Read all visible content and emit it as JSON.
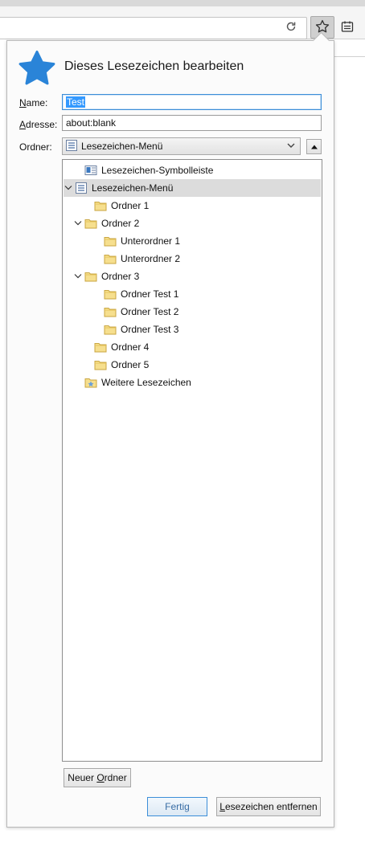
{
  "toolbar": {
    "reload_icon": "reload-icon",
    "star_icon": "star-outline-icon",
    "library_icon": "bookmarks-library-icon"
  },
  "panel": {
    "title": "Dieses Lesezeichen bearbeiten",
    "name_label": "Name:",
    "name_value": "Test",
    "address_label": "Adresse:",
    "address_value": "about:blank",
    "folder_label": "Ordner:",
    "folder_selected": "Lesezeichen-Menü"
  },
  "tree": {
    "items": [
      {
        "label": "Lesezeichen-Symbolleiste",
        "icon": "bookmarks-toolbar-icon"
      },
      {
        "label": "Lesezeichen-Menü",
        "icon": "bookmarks-menu-icon",
        "expanded": true,
        "selected": true
      },
      {
        "label": "Ordner 1",
        "icon": "folder-icon"
      },
      {
        "label": "Ordner 2",
        "icon": "folder-icon",
        "expanded": true
      },
      {
        "label": "Unterordner 1",
        "icon": "folder-icon"
      },
      {
        "label": "Unterordner 2",
        "icon": "folder-icon"
      },
      {
        "label": "Ordner 3",
        "icon": "folder-icon",
        "expanded": true
      },
      {
        "label": "Ordner Test 1",
        "icon": "folder-icon"
      },
      {
        "label": "Ordner Test 2",
        "icon": "folder-icon"
      },
      {
        "label": "Ordner Test 3",
        "icon": "folder-icon"
      },
      {
        "label": "Ordner 4",
        "icon": "folder-icon"
      },
      {
        "label": "Ordner 5",
        "icon": "folder-icon"
      },
      {
        "label": "Weitere Lesezeichen",
        "icon": "other-bookmarks-icon"
      }
    ]
  },
  "buttons": {
    "new_folder": "Neuer Ordner",
    "done": "Fertig",
    "remove": "Lesezeichen entfernen"
  },
  "colors": {
    "accent": "#2a84d8",
    "selection": "#3399ff",
    "row_selected": "#dcdcdc",
    "folder": "#f3d87a"
  }
}
